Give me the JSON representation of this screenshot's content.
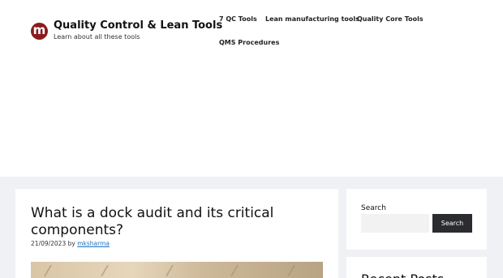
{
  "header": {
    "logo_letter": "m",
    "title": "Quality Control & Lean Tools",
    "tagline": "Learn about all these tools"
  },
  "nav": {
    "items": [
      {
        "label": "7 QC Tools"
      },
      {
        "label": "Lean manufacturing tools"
      },
      {
        "label": "Quality Core Tools"
      },
      {
        "label": "QMS Procedures"
      }
    ]
  },
  "article": {
    "title": "What is a dock audit and its critical components?",
    "date": "21/09/2023",
    "by": "by",
    "author": "mksharma"
  },
  "sidebar": {
    "search": {
      "title": "Search",
      "input_value": "",
      "button_label": "Search"
    },
    "recent": {
      "title": "Recent Posts"
    }
  },
  "colors": {
    "logo_bg": "#8b1a1f",
    "content_bg": "#f0f1f4",
    "button_bg": "#2a2c30",
    "link": "#1e73be"
  }
}
